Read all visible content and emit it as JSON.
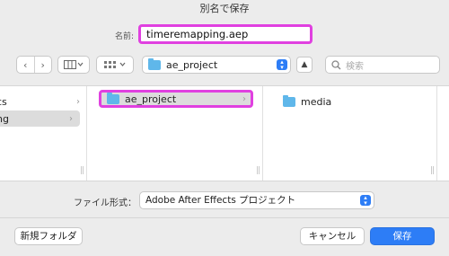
{
  "window": {
    "title": "別名で保存"
  },
  "name_field": {
    "label": "名前:",
    "value": "timeremapping.aep"
  },
  "toolbar": {
    "back_icon": "chevron-left-icon",
    "forward_icon": "chevron-right-icon",
    "view_icon": "columns-view-icon",
    "group_icon": "grid-group-icon",
    "location": "ae_project",
    "search_placeholder": "検索"
  },
  "browser": {
    "column1": [
      {
        "label": "cs",
        "selected": false
      },
      {
        "label": "ng",
        "selected": true
      }
    ],
    "column2": [
      {
        "label": "ae_project",
        "selected": true
      }
    ],
    "column3": [
      {
        "label": "media",
        "selected": false
      }
    ]
  },
  "format": {
    "label": "ファイル形式：",
    "value": "Adobe After Effects プロジェクト"
  },
  "buttons": {
    "new_folder": "新規フォルダ",
    "cancel": "キャンセル",
    "save": "保存"
  },
  "colors": {
    "accent": "#2d7df6",
    "highlight": "#e040e0",
    "folder": "#5fb7ea"
  }
}
